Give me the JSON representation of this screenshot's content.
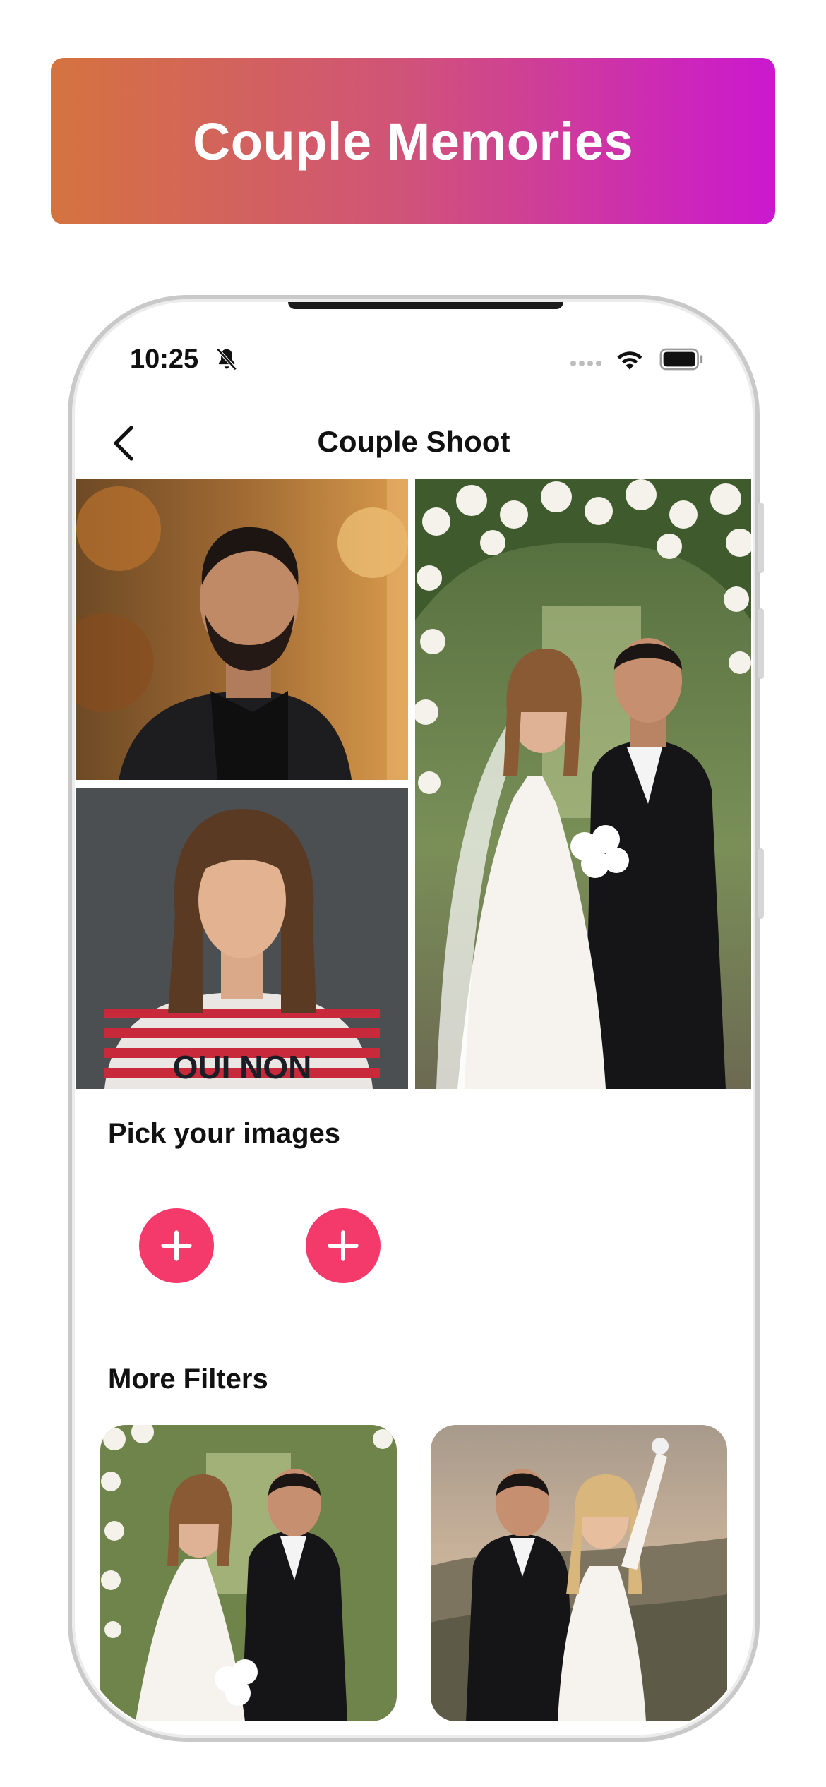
{
  "banner": {
    "title": "Couple Memories"
  },
  "status_bar": {
    "time": "10:25"
  },
  "nav": {
    "title": "Couple Shoot"
  },
  "pick_section": {
    "title": "Pick your images"
  },
  "filters_section": {
    "title": "More Filters"
  },
  "photo_content": {
    "sweater_text": "OUI NON"
  },
  "colors": {
    "banner_start": "#d5733f",
    "banner_end": "#cb18cf",
    "accent_pink": "#f43a6b"
  }
}
